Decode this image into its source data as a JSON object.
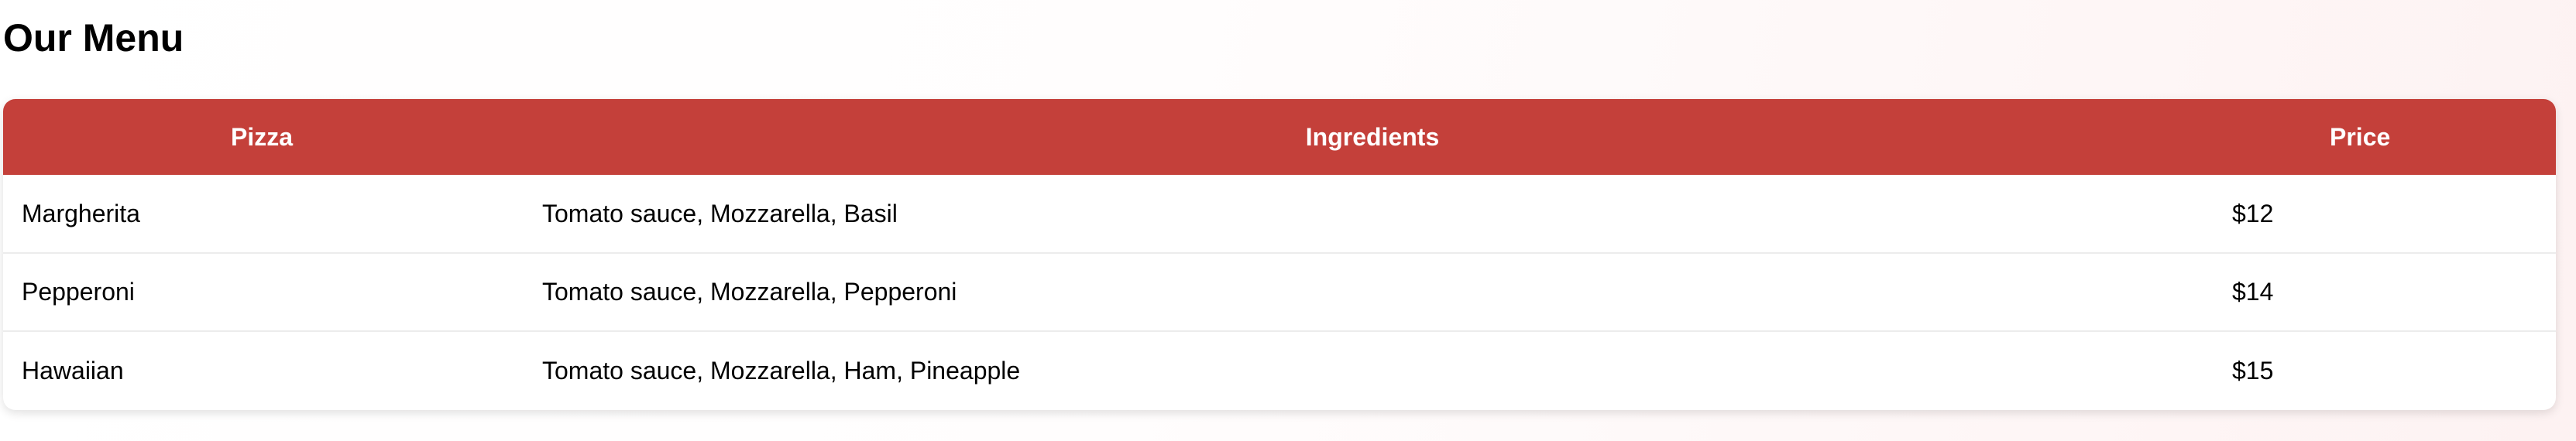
{
  "page": {
    "title": "Our Menu"
  },
  "table": {
    "headers": {
      "pizza": "Pizza",
      "ingredients": "Ingredients",
      "price": "Price"
    },
    "rows": [
      {
        "pizza": "Margherita",
        "ingredients": "Tomato sauce, Mozzarella, Basil",
        "price": "$12"
      },
      {
        "pizza": "Pepperoni",
        "ingredients": "Tomato sauce, Mozzarella, Pepperoni",
        "price": "$14"
      },
      {
        "pizza": "Hawaiian",
        "ingredients": "Tomato sauce, Mozzarella, Ham, Pineapple",
        "price": "$15"
      }
    ]
  },
  "colors": {
    "header_background": "#c4403a",
    "header_text": "#ffffff",
    "row_divider": "#ececec"
  }
}
